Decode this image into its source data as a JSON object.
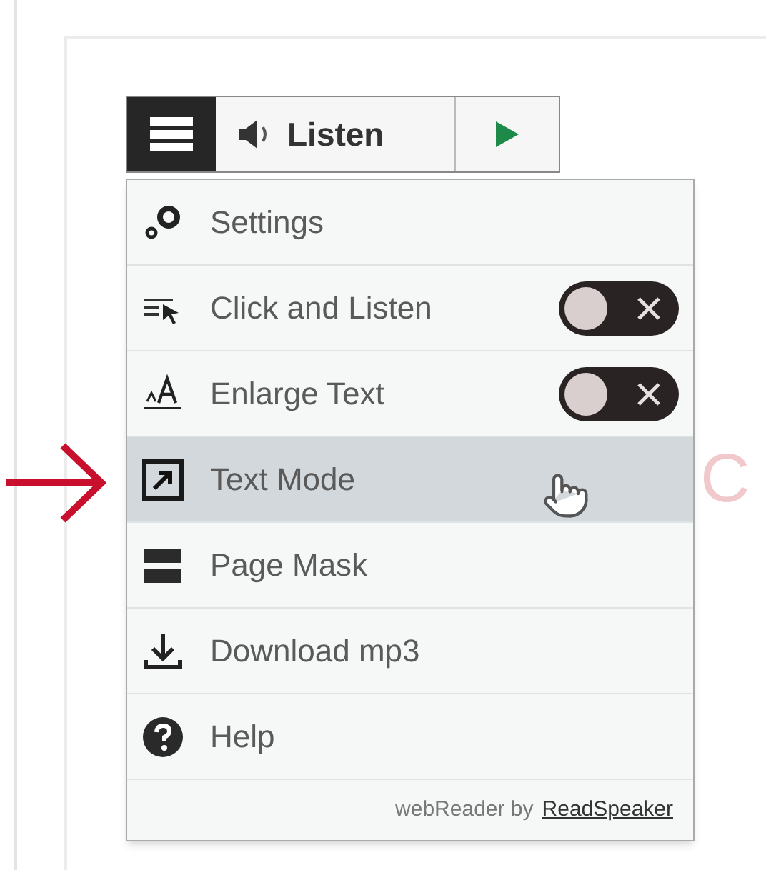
{
  "toolbar": {
    "listen_label": "Listen"
  },
  "menu": {
    "items": [
      {
        "kind": "link",
        "label": "Settings",
        "selected": false
      },
      {
        "kind": "toggle",
        "label": "Click and Listen",
        "selected": false,
        "on": false
      },
      {
        "kind": "toggle",
        "label": "Enlarge Text",
        "selected": false,
        "on": false
      },
      {
        "kind": "link",
        "label": "Text Mode",
        "selected": true
      },
      {
        "kind": "link",
        "label": "Page Mask",
        "selected": false
      },
      {
        "kind": "link",
        "label": "Download mp3",
        "selected": false
      },
      {
        "kind": "link",
        "label": "Help",
        "selected": false
      }
    ],
    "footer": {
      "text": "webReader by",
      "link": "ReadSpeaker"
    }
  },
  "background_text": "C"
}
